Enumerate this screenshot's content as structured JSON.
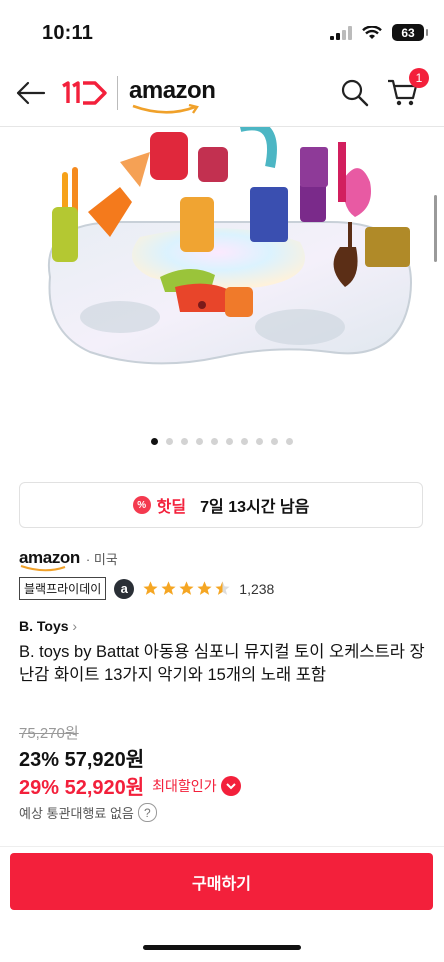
{
  "status_bar": {
    "time": "10:11",
    "battery": "63"
  },
  "nav": {
    "brand_11": "11",
    "amazon": "amazon",
    "cart_count": "1"
  },
  "carousel": {
    "count": 10,
    "active": 0
  },
  "hotdeal": {
    "label": "핫딜",
    "remaining": "7일 13시간 남음"
  },
  "seller": {
    "logo": "amazon",
    "country": "· 미국",
    "badge": "블랙프라이데이",
    "rating": 4.5,
    "reviews": "1,238"
  },
  "product": {
    "brand": "B. Toys",
    "title": "B. toys by Battat 아동용 심포니 뮤지컬 토이 오케스트라 장난감 화이트 13가지 악기와 15개의 노래 포함",
    "original_price": "75,270원",
    "discount_price": "23% 57,920원",
    "max_discount_price": "29% 52,920원",
    "max_discount_label": "최대할인가",
    "tax_note": "예상 통관대행료 없음"
  },
  "buy_button": "구매하기",
  "colors": {
    "accent": "#f3203b"
  }
}
